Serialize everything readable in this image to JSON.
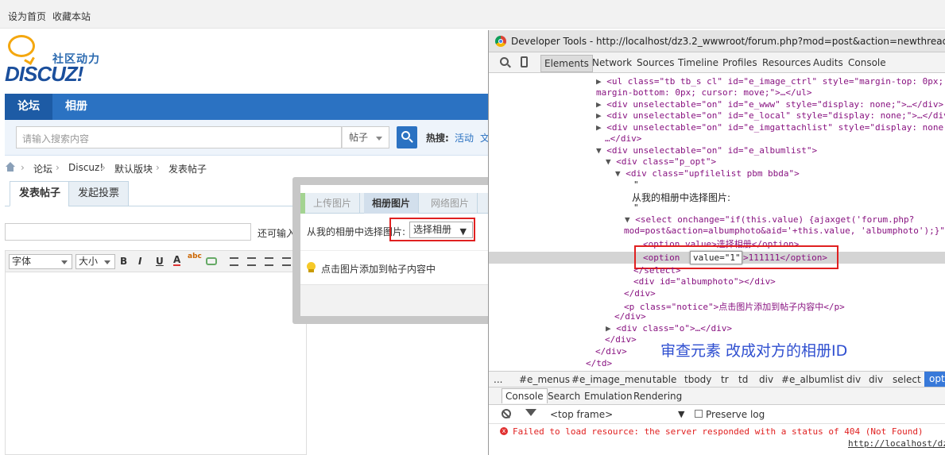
{
  "topbar": {
    "set_home": "设为首页",
    "favorite": "收藏本站"
  },
  "logo": {
    "cn": "社区动力",
    "en": "DISCUZ!"
  },
  "nav": {
    "items": [
      "论坛",
      "相册"
    ]
  },
  "search": {
    "placeholder": "请输入搜索内容",
    "type": "帖子",
    "hot_label": "热搜:",
    "hot_item": "活动",
    "hot_item2": "文"
  },
  "breadcrumb": {
    "items": [
      "论坛",
      "Discuz!",
      "默认版块",
      "发表帖子"
    ],
    "sep": "›"
  },
  "tabs": {
    "post": "发表帖子",
    "poll": "发起投票"
  },
  "subject": {
    "tip": "还可输入"
  },
  "editor": {
    "font": "字体",
    "size": "大小",
    "bold": "B",
    "italic": "I",
    "underline": "U",
    "color": "A",
    "spell": "abc"
  },
  "popup": {
    "tabs": [
      "上传图片",
      "相册图片",
      "网络图片"
    ],
    "album_label": "从我的相册中选择图片:",
    "album_select": "选择相册",
    "album_tri": "▼",
    "notice": "点击图片添加到帖子内容中"
  },
  "devtools": {
    "title": "Developer Tools - http://localhost/dz3.2_wwwroot/forum.php?mod=post&action=newthread&",
    "tabs": [
      "Elements",
      "Network",
      "Sources",
      "Timeline",
      "Profiles",
      "Resources",
      "Audits",
      "Console"
    ],
    "lines": [
      {
        "t": "▶",
        "c": "<ul class=\"tb tb_s cl\" id=\"e_image_ctrl\" style=\"margin-top: 0px;"
      },
      {
        "t": "",
        "c": "margin-bottom: 0px; cursor: move;\">…</ul>"
      },
      {
        "t": "▶",
        "c": "<div unselectable=\"on\" id=\"e_www\" style=\"display: none;\">…</div>"
      },
      {
        "t": "▶",
        "c": "<div unselectable=\"on\" id=\"e_local\" style=\"display: none;\">…</div>"
      },
      {
        "t": "▶",
        "c": "<div unselectable=\"on\" id=\"e_imgattachlist\" style=\"display: none;"
      },
      {
        "t": "",
        "c": "…</div>"
      },
      {
        "t": "▼",
        "c": "<div unselectable=\"on\" id=\"e_albumlist\">"
      },
      {
        "t": "▼",
        "c": "<div class=\"p_opt\">"
      },
      {
        "t": "▼",
        "c": "<div class=\"upfilelist pbm bbda\">"
      },
      {
        "t": "",
        "c": "\""
      },
      {
        "t": "",
        "c": "从我的相册中选择图片:"
      },
      {
        "t": "",
        "c": "\""
      },
      {
        "t": "▼",
        "c": "<select onchange=\"if(this.value) {ajaxget('forum.php?"
      },
      {
        "t": "",
        "c": "mod=post&action=albumphoto&aid='+this.value, 'albumphoto');}\""
      },
      {
        "t": "",
        "c": "<option value>选择相册</option>"
      },
      {
        "t": "",
        "c": "<option"
      },
      {
        "t": "",
        "c": "</select>"
      },
      {
        "t": "",
        "c": "<div id=\"albumphoto\"></div>"
      },
      {
        "t": "",
        "c": "</div>"
      },
      {
        "t": "",
        "c": "<p class=\"notice\">点击图片添加到帖子内容中</p>"
      },
      {
        "t": "",
        "c": "</div>"
      },
      {
        "t": "▶",
        "c": "<div class=\"o\">…</div>"
      },
      {
        "t": "",
        "c": "</div>"
      },
      {
        "t": "",
        "c": "</div>"
      },
      {
        "t": "",
        "c": "</td>"
      }
    ],
    "edit_value": "value=\"1\"",
    "after_edit": ">111111</option>",
    "annotation": "审查元素 改成对方的相册ID",
    "crumbs": [
      "...",
      "#e_menus",
      "#e_image_menu",
      "table",
      "tbody",
      "tr",
      "td",
      "div",
      "#e_albumlist",
      "div",
      "div",
      "select",
      "opti"
    ],
    "drawer_tabs": [
      "Console",
      "Search",
      "Emulation",
      "Rendering"
    ],
    "frame": "<top frame>",
    "frame_caret": "▼",
    "preserve": "Preserve log",
    "error_icon": "x",
    "error": "Failed to load resource: the server responded with a status of 404 (Not Found)",
    "error_link": "http://localhost/dz"
  }
}
